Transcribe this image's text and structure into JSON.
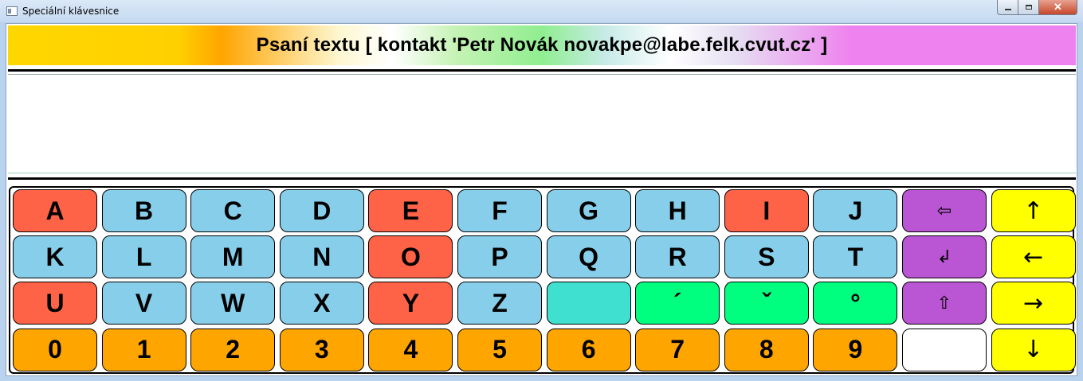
{
  "window": {
    "title": "Speciální klávesnice",
    "close_label": "✕"
  },
  "banner": {
    "text": "Psaní textu [ kontakt 'Petr Novák novakpe@labe.felk.cvut.cz' ]"
  },
  "editor": {
    "value": ""
  },
  "colors": {
    "vowel": "#ff6347",
    "consonant": "#87ceeb",
    "action": "#ba55d3",
    "arrow": "#ffff00",
    "space": "#40e0d0",
    "diacritic": "#00ff7f",
    "digit": "#ffa500"
  },
  "keyboard": {
    "rows": [
      [
        {
          "label": "A",
          "name": "key-a"
        },
        {
          "label": "B",
          "name": "key-b"
        },
        {
          "label": "C",
          "name": "key-c"
        },
        {
          "label": "D",
          "name": "key-d"
        },
        {
          "label": "E",
          "name": "key-e"
        },
        {
          "label": "F",
          "name": "key-f"
        },
        {
          "label": "G",
          "name": "key-g"
        },
        {
          "label": "H",
          "name": "key-h"
        },
        {
          "label": "I",
          "name": "key-i"
        },
        {
          "label": "J",
          "name": "key-j"
        },
        {
          "label": "⇦",
          "name": "backspace-key"
        },
        {
          "label": "↑",
          "name": "arrow-up-key"
        }
      ],
      [
        {
          "label": "K",
          "name": "key-k"
        },
        {
          "label": "L",
          "name": "key-l"
        },
        {
          "label": "M",
          "name": "key-m"
        },
        {
          "label": "N",
          "name": "key-n"
        },
        {
          "label": "O",
          "name": "key-o"
        },
        {
          "label": "P",
          "name": "key-p"
        },
        {
          "label": "Q",
          "name": "key-q"
        },
        {
          "label": "R",
          "name": "key-r"
        },
        {
          "label": "S",
          "name": "key-s"
        },
        {
          "label": "T",
          "name": "key-t"
        },
        {
          "label": "↲",
          "name": "enter-key"
        },
        {
          "label": "←",
          "name": "arrow-left-key"
        }
      ],
      [
        {
          "label": "U",
          "name": "key-u"
        },
        {
          "label": "V",
          "name": "key-v"
        },
        {
          "label": "W",
          "name": "key-w"
        },
        {
          "label": "X",
          "name": "key-x"
        },
        {
          "label": "Y",
          "name": "key-y"
        },
        {
          "label": "Z",
          "name": "key-z"
        },
        {
          "label": "",
          "name": "space-key"
        },
        {
          "label": "´",
          "name": "acute-accent-key"
        },
        {
          "label": "ˇ",
          "name": "caron-key"
        },
        {
          "label": "°",
          "name": "ring-key"
        },
        {
          "label": "⇧",
          "name": "shift-key"
        },
        {
          "label": "→",
          "name": "arrow-right-key"
        }
      ],
      [
        {
          "label": "0",
          "name": "key-0"
        },
        {
          "label": "1",
          "name": "key-1"
        },
        {
          "label": "2",
          "name": "key-2"
        },
        {
          "label": "3",
          "name": "key-3"
        },
        {
          "label": "4",
          "name": "key-4"
        },
        {
          "label": "5",
          "name": "key-5"
        },
        {
          "label": "6",
          "name": "key-6"
        },
        {
          "label": "7",
          "name": "key-7"
        },
        {
          "label": "8",
          "name": "key-8"
        },
        {
          "label": "9",
          "name": "key-9"
        },
        {
          "label": "",
          "name": "blank-key"
        },
        {
          "label": "↓",
          "name": "arrow-down-key"
        }
      ]
    ]
  }
}
